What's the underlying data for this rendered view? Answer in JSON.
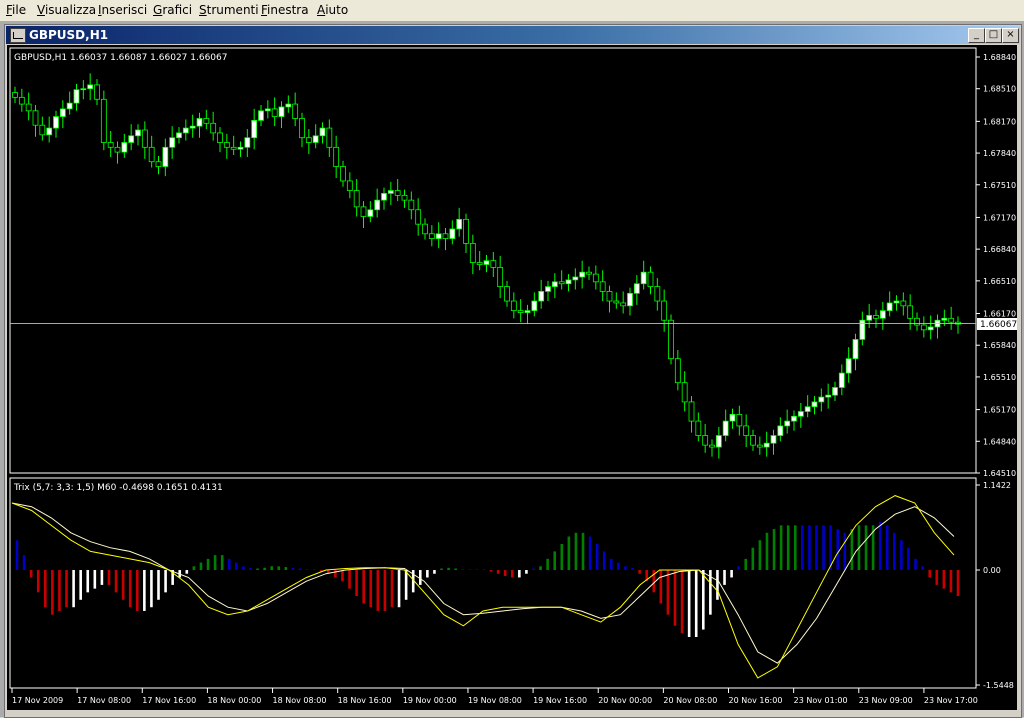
{
  "menu": {
    "items": [
      {
        "key": "file",
        "acc": "F",
        "rest": "ile"
      },
      {
        "key": "visualizza",
        "acc": "V",
        "rest": "isualizza"
      },
      {
        "key": "inserisci",
        "acc": "I",
        "rest": "nserisci"
      },
      {
        "key": "grafici",
        "acc": "G",
        "rest": "rafici"
      },
      {
        "key": "strumenti",
        "acc": "S",
        "rest": "trumenti"
      },
      {
        "key": "finestra",
        "acc": "F",
        "rest": "inestra"
      },
      {
        "key": "aiuto",
        "acc": "A",
        "rest": "iuto"
      }
    ]
  },
  "window": {
    "title": "GBPUSD,H1",
    "btn_min": "_",
    "btn_max": "□",
    "btn_close": "×"
  },
  "chart": {
    "info": "GBPUSD,H1  1.66037 1.66087 1.66027 1.66067",
    "price_ticks": [
      "1.68840",
      "1.68510",
      "1.68170",
      "1.67840",
      "1.67510",
      "1.67170",
      "1.66840",
      "1.66510",
      "1.66170",
      "1.65840",
      "1.65510",
      "1.65170",
      "1.64840",
      "1.64510"
    ],
    "current_price": "1.66067",
    "indicator_label": "Trix (5,7: 3,3: 1,5) M60  -0.4698 0.1651 0.4131",
    "indicator_ticks": [
      "1.1422",
      "0.00",
      "-1.5448"
    ],
    "time_labels": [
      "17 Nov 2009",
      "17 Nov 08:00",
      "17 Nov 16:00",
      "18 Nov 00:00",
      "18 Nov 08:00",
      "18 Nov 16:00",
      "19 Nov 00:00",
      "19 Nov 08:00",
      "19 Nov 16:00",
      "20 Nov 00:00",
      "20 Nov 08:00",
      "20 Nov 16:00",
      "23 Nov 01:00",
      "23 Nov 09:00",
      "23 Nov 17:00"
    ],
    "colors": {
      "background": "#000000",
      "axis": "#ffffff",
      "bull_candle": "#ffffff",
      "bear_candle": "#000000",
      "wick": "#00ff00",
      "bid_line": "#c0c0c0",
      "trix_line": "#ffff00",
      "signal_line": "#fffacd",
      "hist_green": "#008000",
      "hist_blue": "#0000c8",
      "hist_red": "#c80000",
      "hist_white": "#ffffff"
    },
    "closes": [
      1.6842,
      1.6835,
      1.6828,
      1.6813,
      1.6803,
      1.681,
      1.6822,
      1.683,
      1.6836,
      1.685,
      1.6851,
      1.6855,
      1.684,
      1.6795,
      1.679,
      1.6785,
      1.6795,
      1.6802,
      1.6808,
      1.679,
      1.6775,
      1.677,
      1.679,
      1.68,
      1.6805,
      1.681,
      1.6812,
      1.682,
      1.6815,
      1.6805,
      1.6795,
      1.679,
      1.6788,
      1.679,
      1.68,
      1.6818,
      1.6828,
      1.683,
      1.6822,
      1.6832,
      1.6835,
      1.682,
      1.68,
      1.6795,
      1.6802,
      1.681,
      1.679,
      1.677,
      1.6755,
      1.6745,
      1.6728,
      1.6718,
      1.6725,
      1.6735,
      1.6742,
      1.6745,
      1.674,
      1.6735,
      1.6725,
      1.671,
      1.67,
      1.6695,
      1.67,
      1.6695,
      1.6705,
      1.6715,
      1.669,
      1.667,
      1.6668,
      1.6672,
      1.6665,
      1.6645,
      1.663,
      1.662,
      1.6618,
      1.662,
      1.663,
      1.664,
      1.6645,
      1.665,
      1.6648,
      1.6652,
      1.6655,
      1.666,
      1.6658,
      1.665,
      1.664,
      1.663,
      1.6628,
      1.6625,
      1.6638,
      1.6648,
      1.666,
      1.6645,
      1.663,
      1.661,
      1.657,
      1.6545,
      1.6525,
      1.6505,
      1.649,
      1.648,
      1.6478,
      1.649,
      1.6505,
      1.6512,
      1.65,
      1.649,
      1.648,
      1.6478,
      1.6482,
      1.649,
      1.65,
      1.6505,
      1.651,
      1.6515,
      1.652,
      1.6525,
      1.653,
      1.6532,
      1.654,
      1.6555,
      1.657,
      1.659,
      1.661,
      1.6615,
      1.6612,
      1.662,
      1.6628,
      1.663,
      1.6625,
      1.6612,
      1.6605,
      1.66,
      1.6603,
      1.661,
      1.6612,
      1.6608,
      1.6606
    ],
    "trix_ticks_note": "",
    "hist": [
      [
        "b",
        0.4
      ],
      [
        "b",
        0.2
      ],
      [
        "r",
        -0.1
      ],
      [
        "r",
        -0.3
      ],
      [
        "r",
        -0.5
      ],
      [
        "r",
        -0.6
      ],
      [
        "r",
        -0.55
      ],
      [
        "r",
        -0.5
      ],
      [
        "w",
        -0.5
      ],
      [
        "w",
        -0.4
      ],
      [
        "w",
        -0.3
      ],
      [
        "w",
        -0.25
      ],
      [
        "w",
        -0.2
      ],
      [
        "r",
        -0.2
      ],
      [
        "r",
        -0.3
      ],
      [
        "r",
        -0.4
      ],
      [
        "r",
        -0.5
      ],
      [
        "r",
        -0.55
      ],
      [
        "w",
        -0.55
      ],
      [
        "w",
        -0.5
      ],
      [
        "w",
        -0.4
      ],
      [
        "w",
        -0.3
      ],
      [
        "w",
        -0.2
      ],
      [
        "w",
        -0.1
      ],
      [
        "w",
        -0.05
      ],
      [
        "g",
        0.05
      ],
      [
        "g",
        0.1
      ],
      [
        "g",
        0.15
      ],
      [
        "g",
        0.2
      ],
      [
        "g",
        0.2
      ],
      [
        "b",
        0.15
      ],
      [
        "b",
        0.1
      ],
      [
        "b",
        0.05
      ],
      [
        "b",
        0.03
      ],
      [
        "g",
        0.02
      ],
      [
        "g",
        0.03
      ],
      [
        "g",
        0.05
      ],
      [
        "g",
        0.05
      ],
      [
        "g",
        0.04
      ],
      [
        "b",
        0.03
      ],
      [
        "b",
        0.02
      ],
      [
        "b",
        0.01
      ],
      [
        "b",
        0.01
      ],
      [
        "r",
        -0.02
      ],
      [
        "r",
        -0.05
      ],
      [
        "r",
        -0.1
      ],
      [
        "r",
        -0.15
      ],
      [
        "r",
        -0.25
      ],
      [
        "r",
        -0.35
      ],
      [
        "r",
        -0.45
      ],
      [
        "r",
        -0.5
      ],
      [
        "r",
        -0.55
      ],
      [
        "r",
        -0.55
      ],
      [
        "r",
        -0.5
      ],
      [
        "w",
        -0.5
      ],
      [
        "w",
        -0.4
      ],
      [
        "w",
        -0.3
      ],
      [
        "w",
        -0.2
      ],
      [
        "w",
        -0.1
      ],
      [
        "w",
        -0.05
      ],
      [
        "g",
        0.02
      ],
      [
        "g",
        0.03
      ],
      [
        "g",
        0.02
      ],
      [
        "b",
        0.01
      ],
      [
        "b",
        0.01
      ],
      [
        "b",
        0.01
      ],
      [
        "b",
        0.01
      ],
      [
        "r",
        -0.02
      ],
      [
        "r",
        -0.05
      ],
      [
        "r",
        -0.08
      ],
      [
        "r",
        -0.1
      ],
      [
        "w",
        -0.1
      ],
      [
        "w",
        -0.05
      ],
      [
        "b",
        0.02
      ],
      [
        "g",
        0.05
      ],
      [
        "g",
        0.15
      ],
      [
        "g",
        0.25
      ],
      [
        "g",
        0.35
      ],
      [
        "g",
        0.45
      ],
      [
        "g",
        0.5
      ],
      [
        "g",
        0.5
      ],
      [
        "b",
        0.45
      ],
      [
        "b",
        0.35
      ],
      [
        "b",
        0.25
      ],
      [
        "b",
        0.15
      ],
      [
        "b",
        0.1
      ],
      [
        "b",
        0.05
      ],
      [
        "b",
        0.03
      ],
      [
        "r",
        -0.05
      ],
      [
        "r",
        -0.15
      ],
      [
        "r",
        -0.3
      ],
      [
        "r",
        -0.45
      ],
      [
        "r",
        -0.6
      ],
      [
        "r",
        -0.75
      ],
      [
        "r",
        -0.85
      ],
      [
        "w",
        -0.9
      ],
      [
        "w",
        -0.9
      ],
      [
        "w",
        -0.8
      ],
      [
        "w",
        -0.6
      ],
      [
        "w",
        -0.4
      ],
      [
        "w",
        -0.2
      ],
      [
        "w",
        -0.1
      ],
      [
        "b",
        0.05
      ],
      [
        "g",
        0.15
      ],
      [
        "g",
        0.3
      ],
      [
        "g",
        0.4
      ],
      [
        "g",
        0.5
      ],
      [
        "g",
        0.55
      ],
      [
        "g",
        0.6
      ],
      [
        "g",
        0.6
      ],
      [
        "g",
        0.6
      ],
      [
        "b",
        0.6
      ],
      [
        "b",
        0.6
      ],
      [
        "b",
        0.6
      ],
      [
        "b",
        0.6
      ],
      [
        "b",
        0.6
      ],
      [
        "b",
        0.55
      ],
      [
        "b",
        0.5
      ],
      [
        "g",
        0.55
      ],
      [
        "g",
        0.6
      ],
      [
        "g",
        0.6
      ],
      [
        "g",
        0.6
      ],
      [
        "b",
        0.65
      ],
      [
        "b",
        0.6
      ],
      [
        "b",
        0.5
      ],
      [
        "b",
        0.4
      ],
      [
        "b",
        0.3
      ],
      [
        "b",
        0.15
      ],
      [
        "b",
        0.05
      ],
      [
        "r",
        -0.1
      ],
      [
        "r",
        -0.2
      ],
      [
        "r",
        -0.25
      ],
      [
        "r",
        -0.3
      ],
      [
        "r",
        -0.35
      ]
    ],
    "trix": [
      0.9,
      0.8,
      0.6,
      0.4,
      0.25,
      0.2,
      0.15,
      0.1,
      0.0,
      -0.2,
      -0.5,
      -0.6,
      -0.55,
      -0.4,
      -0.25,
      -0.1,
      0.0,
      0.02,
      0.03,
      0.03,
      0.0,
      -0.3,
      -0.6,
      -0.75,
      -0.55,
      -0.5,
      -0.5,
      -0.5,
      -0.5,
      -0.6,
      -0.7,
      -0.5,
      -0.2,
      0.0,
      0.0,
      0.0,
      -0.3,
      -1.0,
      -1.45,
      -1.3,
      -0.8,
      -0.3,
      0.2,
      0.6,
      0.85,
      1.0,
      0.9,
      0.5,
      0.2
    ],
    "signal": [
      0.9,
      0.85,
      0.7,
      0.5,
      0.38,
      0.3,
      0.25,
      0.15,
      0.0,
      -0.1,
      -0.35,
      -0.5,
      -0.55,
      -0.45,
      -0.3,
      -0.15,
      -0.05,
      0.0,
      0.02,
      0.03,
      0.02,
      -0.15,
      -0.45,
      -0.6,
      -0.58,
      -0.55,
      -0.52,
      -0.5,
      -0.5,
      -0.55,
      -0.65,
      -0.6,
      -0.35,
      -0.1,
      -0.02,
      0.0,
      -0.15,
      -0.6,
      -1.1,
      -1.25,
      -1.0,
      -0.65,
      -0.2,
      0.25,
      0.55,
      0.75,
      0.85,
      0.7,
      0.45
    ]
  }
}
